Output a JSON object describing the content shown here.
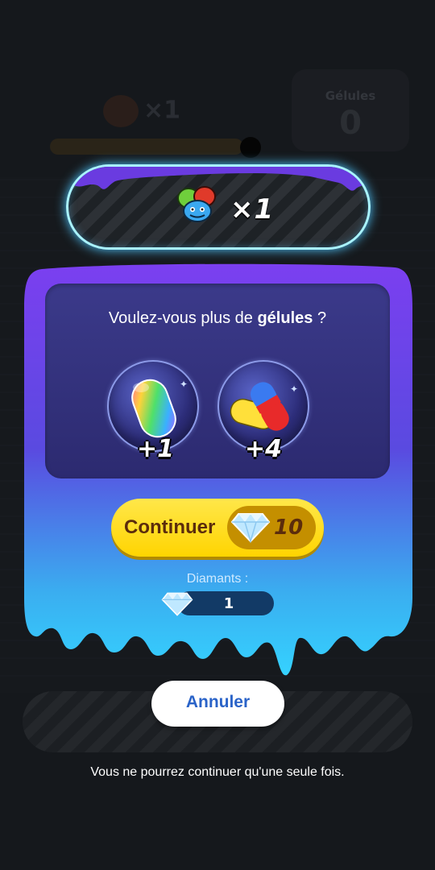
{
  "background": {
    "gelules_label": "Gélules",
    "gelules_value": "0",
    "virus_count": "×1"
  },
  "top_pill": {
    "virus_count": "×1"
  },
  "dialog": {
    "question_prefix": "Voulez-vous plus de ",
    "question_bold": "gélules",
    "question_suffix": " ?",
    "offers": [
      {
        "icon": "rainbow-capsule-icon",
        "bonus": "+1"
      },
      {
        "icon": "red-blue-yellow-capsules-icon",
        "bonus": "+4"
      }
    ],
    "continue_label": "Continuer",
    "continue_cost": "10",
    "diamonds_label": "Diamants :",
    "diamonds_count": "1"
  },
  "cancel_label": "Annuler",
  "footer_note": "Vous ne pourrez continuer qu'une seule fois.",
  "colors": {
    "panel_purple": "#7b3ff0",
    "panel_cyan": "#35d2ff",
    "continue_yellow": "#ffd400",
    "cancel_text_blue": "#2a63c8"
  }
}
